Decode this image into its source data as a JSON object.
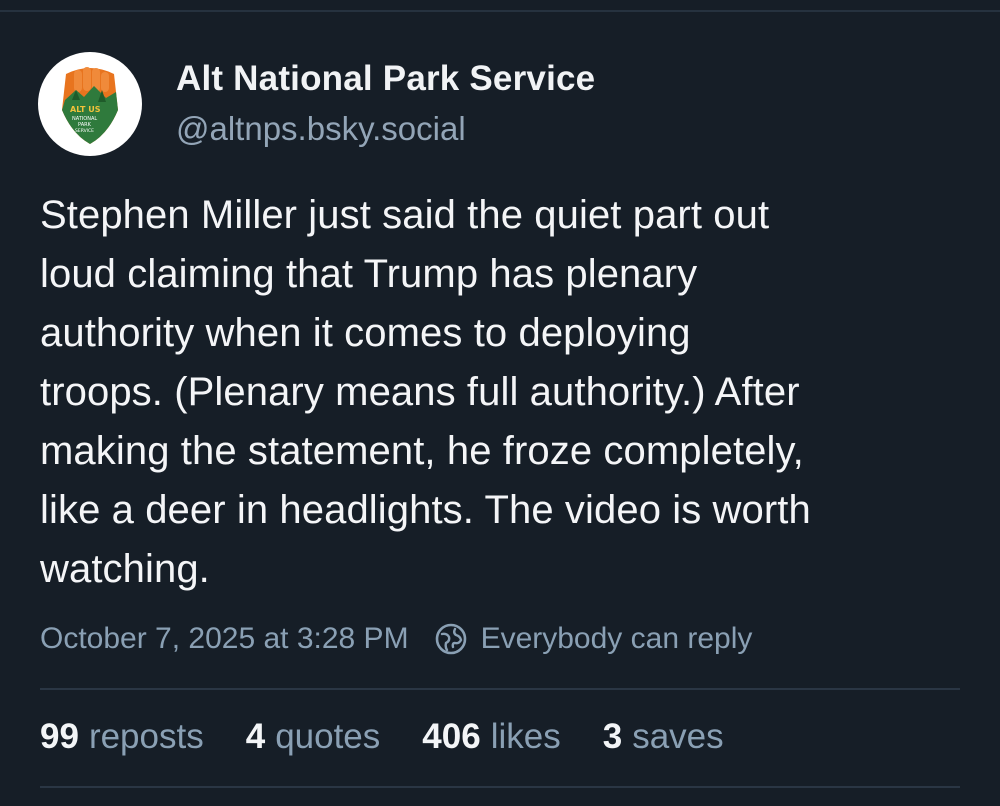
{
  "author": {
    "display_name": "Alt National Park Service",
    "handle": "@altnps.bsky.social",
    "avatar_lettering": [
      "ALT US",
      "NATIONAL",
      "PARK",
      "SERVICE"
    ]
  },
  "post": {
    "text": "Stephen Miller just said the quiet part out\nloud claiming that Trump has plenary\nauthority when it comes to deploying\ntroops. (Plenary means full authority.) After\nmaking the statement, he froze completely,\nlike a deer in headlights. The video is worth\nwatching.",
    "timestamp": "October 7, 2025 at 3:28 PM",
    "reply_setting": "Everybody can reply"
  },
  "stats": [
    {
      "count": "99",
      "label": "reposts"
    },
    {
      "count": "4",
      "label": "quotes"
    },
    {
      "count": "406",
      "label": "likes"
    },
    {
      "count": "3",
      "label": "saves"
    }
  ],
  "colors": {
    "background": "#161e27",
    "text_primary": "#f4f5f7",
    "text_secondary": "#8aa0b4",
    "divider": "#2a3644",
    "avatar_orange": "#e8741e",
    "avatar_green": "#2f7a3c"
  },
  "icons": {
    "reply_setting": "globe-icon"
  }
}
